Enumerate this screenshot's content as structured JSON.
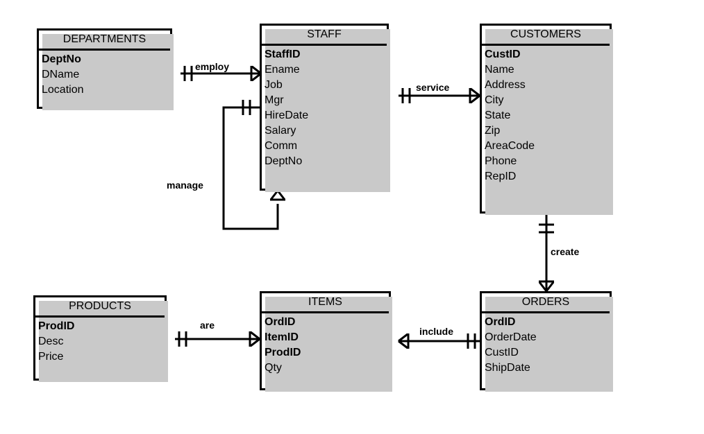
{
  "diagram": {
    "type": "entity-relationship-diagram",
    "notation": "crow's foot",
    "background": "#ffffff",
    "line_color": "#000000",
    "shadow_color": "#c9c9c9"
  },
  "entities": [
    {
      "name": "DEPARTMENTS",
      "attributes": [
        {
          "label": "DeptNo",
          "key": true
        },
        {
          "label": "DName",
          "key": false
        },
        {
          "label": "Location",
          "key": false
        }
      ]
    },
    {
      "name": "STAFF",
      "attributes": [
        {
          "label": "StaffID",
          "key": true
        },
        {
          "label": "Ename",
          "key": false
        },
        {
          "label": "Job",
          "key": false
        },
        {
          "label": "Mgr",
          "key": false
        },
        {
          "label": "HireDate",
          "key": false
        },
        {
          "label": "Salary",
          "key": false
        },
        {
          "label": "Comm",
          "key": false
        },
        {
          "label": "DeptNo",
          "key": false
        }
      ]
    },
    {
      "name": "CUSTOMERS",
      "attributes": [
        {
          "label": "CustID",
          "key": true
        },
        {
          "label": "Name",
          "key": false
        },
        {
          "label": "Address",
          "key": false
        },
        {
          "label": "City",
          "key": false
        },
        {
          "label": "State",
          "key": false
        },
        {
          "label": "Zip",
          "key": false
        },
        {
          "label": "AreaCode",
          "key": false
        },
        {
          "label": "Phone",
          "key": false
        },
        {
          "label": "RepID",
          "key": false
        }
      ]
    },
    {
      "name": "PRODUCTS",
      "attributes": [
        {
          "label": "ProdID",
          "key": true
        },
        {
          "label": "Desc",
          "key": false
        },
        {
          "label": "Price",
          "key": false
        }
      ]
    },
    {
      "name": "ITEMS",
      "attributes": [
        {
          "label": "OrdID",
          "key": true
        },
        {
          "label": "ItemID",
          "key": true
        },
        {
          "label": "ProdID",
          "key": true
        },
        {
          "label": "Qty",
          "key": false
        }
      ]
    },
    {
      "name": "ORDERS",
      "attributes": [
        {
          "label": "OrdID",
          "key": true
        },
        {
          "label": "OrderDate",
          "key": false
        },
        {
          "label": "CustID",
          "key": false
        },
        {
          "label": "ShipDate",
          "key": false
        }
      ]
    }
  ],
  "relationships": [
    {
      "label": "employ",
      "from": "DEPARTMENTS",
      "to": "STAFF",
      "from_cardinality": "one-and-only-one",
      "to_cardinality": "one-to-many"
    },
    {
      "label": "service",
      "from": "STAFF",
      "to": "CUSTOMERS",
      "from_cardinality": "one-and-only-one",
      "to_cardinality": "one-to-many"
    },
    {
      "label": "manage",
      "from": "STAFF",
      "to": "STAFF",
      "from_cardinality": "one-and-only-one",
      "to_cardinality": "one-to-many"
    },
    {
      "label": "create",
      "from": "CUSTOMERS",
      "to": "ORDERS",
      "from_cardinality": "one-and-only-one",
      "to_cardinality": "one-to-many"
    },
    {
      "label": "are",
      "from": "PRODUCTS",
      "to": "ITEMS",
      "from_cardinality": "one-and-only-one",
      "to_cardinality": "one-to-many"
    },
    {
      "label": "include",
      "from": "ITEMS",
      "to": "ORDERS",
      "from_cardinality": "one-to-many",
      "to_cardinality": "one-and-only-one"
    }
  ]
}
